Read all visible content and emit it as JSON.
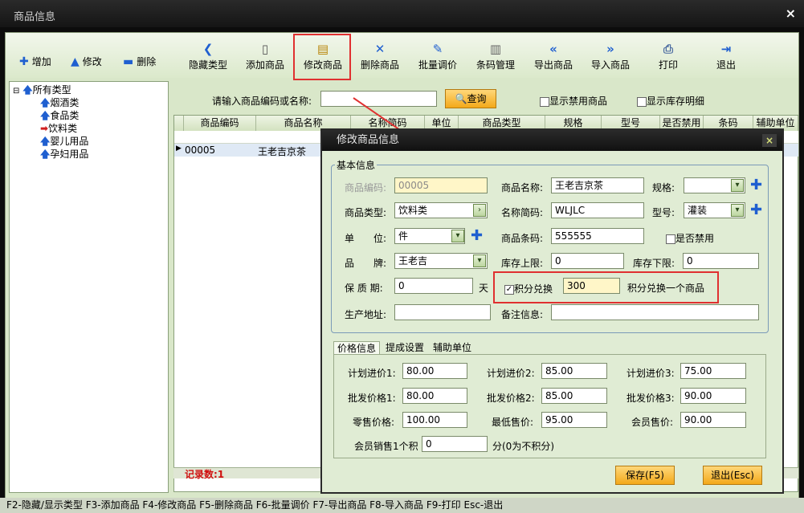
{
  "window": {
    "title": "商品信息",
    "close": "×"
  },
  "toolbar": {
    "side": [
      {
        "label": "增加",
        "icon": "plus-icon"
      },
      {
        "label": "修改",
        "icon": "triangle-up-icon"
      },
      {
        "label": "删除",
        "icon": "minus-icon"
      }
    ],
    "buttons": [
      {
        "label": "隐藏类型",
        "icon": "chevron-left-icon"
      },
      {
        "label": "添加商品",
        "icon": "document-icon"
      },
      {
        "label": "修改商品",
        "icon": "clipboard-icon"
      },
      {
        "label": "删除商品",
        "icon": "x-icon"
      },
      {
        "label": "批量调价",
        "icon": "pen-icon"
      },
      {
        "label": "条码管理",
        "icon": "barcode-icon"
      },
      {
        "label": "导出商品",
        "icon": "double-chevron-left-icon"
      },
      {
        "label": "导入商品",
        "icon": "double-chevron-right-icon"
      },
      {
        "label": "打印",
        "icon": "printer-icon"
      },
      {
        "label": "退出",
        "icon": "exit-door-icon"
      }
    ]
  },
  "tree": {
    "root": "所有类型",
    "items": [
      "烟酒类",
      "食品类",
      "饮料类",
      "婴儿用品",
      "孕妇用品"
    ]
  },
  "search": {
    "label": "请输入商品编码或名称:",
    "value": "",
    "button": "查询",
    "show_disabled": "显示禁用商品",
    "show_stock": "显示库存明细"
  },
  "grid": {
    "columns": [
      "商品编码",
      "商品名称",
      "名称简码",
      "单位",
      "商品类型",
      "规格",
      "型号",
      "是否禁用",
      "条码",
      "辅助单位"
    ],
    "rows": [
      {
        "code": "00005",
        "name": "王老吉京茶"
      }
    ],
    "record_count": "记录数:1"
  },
  "status_bar": "F2-隐藏/显示类型 F3-添加商品 F4-修改商品 F5-删除商品 F6-批量调价 F7-导出商品 F8-导入商品 F9-打印 Esc-退出",
  "dialog": {
    "title": "修改商品信息",
    "close": "×",
    "group_title": "基本信息",
    "fields": {
      "code_label": "商品编码:",
      "code_value": "00005",
      "name_label": "商品名称:",
      "name_value": "王老吉京茶",
      "spec_label": "规格:",
      "spec_value": "",
      "type_label": "商品类型:",
      "type_value": "饮料类",
      "abbr_label": "名称简码:",
      "abbr_value": "WLJLC",
      "model_label": "型号:",
      "model_value": "灌装",
      "unit_label": "单　　位:",
      "unit_value": "件",
      "barcode_label": "商品条码:",
      "barcode_value": "555555",
      "disabled_label": "是否禁用",
      "brand_label": "品　　牌:",
      "brand_value": "王老吉",
      "stock_max_label": "库存上限:",
      "stock_max_value": "0",
      "stock_min_label": "库存下限:",
      "stock_min_value": "0",
      "shelf_label": "保 质 期:",
      "shelf_value": "0",
      "shelf_unit": "天",
      "points_label": "积分兑换",
      "points_value": "300",
      "points_suffix": "积分兑换一个商品",
      "origin_label": "生产地址:",
      "origin_value": "",
      "note_label": "备注信息:",
      "note_value": ""
    },
    "tabs": [
      "价格信息",
      "提成设置",
      "辅助单位"
    ],
    "prices": {
      "plan1_label": "计划进价1:",
      "plan1": "80.00",
      "plan2_label": "计划进价2:",
      "plan2": "85.00",
      "plan3_label": "计划进价3:",
      "plan3": "75.00",
      "whole1_label": "批发价格1:",
      "whole1": "80.00",
      "whole2_label": "批发价格2:",
      "whole2": "85.00",
      "whole3_label": "批发价格3:",
      "whole3": "90.00",
      "retail_label": "零售价格:",
      "retail": "100.00",
      "min_label": "最低售价:",
      "min": "95.00",
      "member_label": "会员售价:",
      "member": "90.00",
      "points_per_label": "会员销售1个积",
      "points_per": "0",
      "points_per_suffix": "分(0为不积分)"
    },
    "save": "保存(F5)",
    "exit": "退出(Esc)"
  },
  "colors": {
    "highlight": "#e03030",
    "accent": "#1f5fd0",
    "button": "#f3a91a"
  }
}
